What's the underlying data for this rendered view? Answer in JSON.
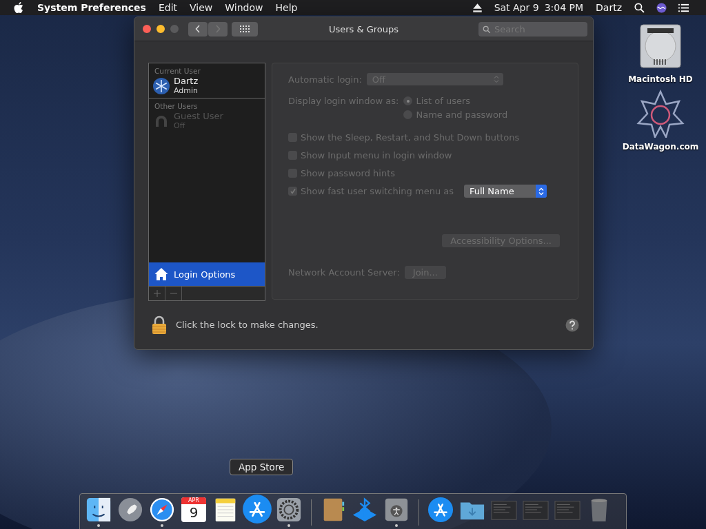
{
  "menubar": {
    "app_name": "System Preferences",
    "menus": [
      "Edit",
      "View",
      "Window",
      "Help"
    ],
    "date": "Sat Apr 9",
    "time": "3:04 PM",
    "user": "Dartz"
  },
  "window": {
    "title": "Users & Groups",
    "search": {
      "placeholder": "Search"
    },
    "sidebar": {
      "sections": [
        {
          "label": "Current User",
          "users": [
            {
              "name": "Dartz",
              "role": "Admin",
              "kind": "admin",
              "disabled": false
            }
          ]
        },
        {
          "label": "Other Users",
          "users": [
            {
              "name": "Guest User",
              "role": "Off",
              "kind": "guest",
              "disabled": true
            }
          ]
        }
      ],
      "login_options": {
        "label": "Login Options",
        "selected": true
      }
    },
    "options": {
      "automatic_login": {
        "label": "Automatic login:",
        "value": "Off"
      },
      "display_as": {
        "label": "Display login window as:",
        "choices": [
          {
            "label": "List of users",
            "selected": true
          },
          {
            "label": "Name and password",
            "selected": false
          }
        ]
      },
      "checkboxes": [
        {
          "label": "Show the Sleep, Restart, and Shut Down buttons",
          "checked": false
        },
        {
          "label": "Show Input menu in login window",
          "checked": false
        },
        {
          "label": "Show password hints",
          "checked": false
        },
        {
          "label": "Show fast user switching menu as",
          "checked": true
        }
      ],
      "switching_value": "Full Name",
      "accessibility_button": "Accessibility Options...",
      "network": {
        "label": "Network Account Server:",
        "button": "Join..."
      }
    },
    "lock_text": "Click the lock to make changes."
  },
  "desktop_icons": [
    {
      "label": "Macintosh HD",
      "kind": "disk"
    },
    {
      "label": "DataWagon.com",
      "kind": "star"
    }
  ],
  "tooltip": "App Store",
  "dock": [
    {
      "kind": "finder",
      "running": true
    },
    {
      "kind": "launchpad",
      "running": false
    },
    {
      "kind": "safari",
      "running": true
    },
    {
      "kind": "calendar",
      "running": false,
      "month": "APR",
      "day": "9"
    },
    {
      "kind": "notes",
      "running": false
    },
    {
      "kind": "appstore",
      "running": false
    },
    {
      "kind": "settings",
      "running": true
    },
    {
      "kind": "separator"
    },
    {
      "kind": "book",
      "running": false
    },
    {
      "kind": "bluetooth",
      "running": false
    },
    {
      "kind": "accessibility",
      "running": true
    },
    {
      "kind": "separator"
    },
    {
      "kind": "appstore",
      "running": false
    },
    {
      "kind": "folder",
      "running": false
    },
    {
      "kind": "window",
      "running": false
    },
    {
      "kind": "window",
      "running": false
    },
    {
      "kind": "window",
      "running": false
    },
    {
      "kind": "trash",
      "running": false
    }
  ]
}
